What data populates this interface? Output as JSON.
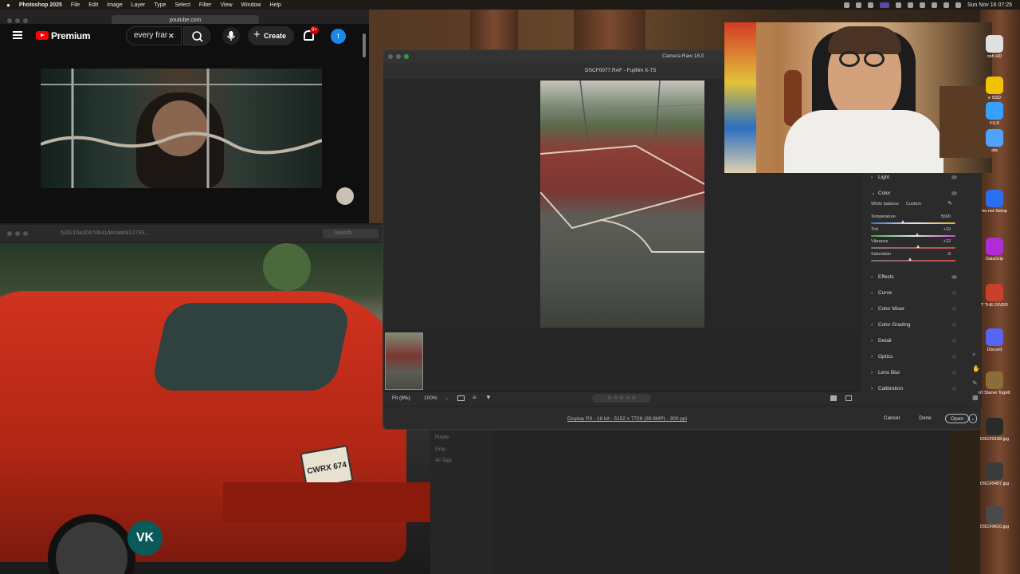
{
  "menubar": {
    "app": "Photoshop 2025",
    "items": [
      "File",
      "Edit",
      "Image",
      "Layer",
      "Type",
      "Select",
      "Filter",
      "View",
      "Window",
      "Help"
    ],
    "clock": "Sun Nov 16 07:25"
  },
  "youtube": {
    "url": "youtube.com",
    "brand": "Premium",
    "search_value": "every frar",
    "create_label": "Create",
    "notif_count": "9+",
    "avatar_letter": "t"
  },
  "viewer": {
    "title": "535215a30470b41de0aab912733...",
    "search_placeholder": "Search"
  },
  "lightroom": {
    "tags": [
      "Purple",
      "Gray",
      "All Tags"
    ]
  },
  "camera_raw": {
    "app_title": "Camera Raw 18.0",
    "file_title": "DSCF0077.RAF  -  Fujifilm X-T5",
    "zoom_fit": "Fit (8%)",
    "zoom_100": "100%",
    "stars": "☆ ☆ ☆ ☆ ☆",
    "footer_info": "Display P3 - 16 bit - 5152 x 7728 (39.8MP) - 300 ppi",
    "cancel": "Cancel",
    "done": "Done",
    "open": "Open",
    "panel": {
      "light": "Light",
      "color": "Color",
      "wb_label": "White balance",
      "wb_value": "Custom",
      "sliders": [
        {
          "label": "Temperature",
          "value": "5500",
          "pos": 0.38
        },
        {
          "label": "Tint",
          "value": "+10",
          "pos": 0.55
        },
        {
          "label": "Vibrance",
          "value": "+12",
          "pos": 0.56
        },
        {
          "label": "Saturation",
          "value": "-8",
          "pos": 0.47
        }
      ],
      "sections": [
        "Effects",
        "Curve",
        "Color Mixer",
        "Color Grading",
        "Detail",
        "Optics",
        "Lens Blur",
        "Calibration"
      ]
    }
  },
  "dock": [
    {
      "label": "osh HD",
      "color": "#e0e0e0"
    },
    {
      "label": "e SSD",
      "color": "#f2c200"
    },
    {
      "label": "FUJI",
      "color": "#3aa0ff"
    },
    {
      "label": "ata",
      "color": "#4fa3ff"
    },
    {
      "label": "ne.net-Setup",
      "color": "#2b6ff0"
    },
    {
      "label": "DataGrip",
      "color": "#b02cd6"
    },
    {
      "label": "T THE DIVER",
      "color": "#c9402a"
    },
    {
      "label": "Discord",
      "color": "#5865f2"
    },
    {
      "label": "n't Starve Together",
      "color": "#8a6d3b"
    },
    {
      "label": "DSCF9158.jpg",
      "color": "#2a2a2a"
    },
    {
      "label": "DSCF9497.jpg",
      "color": "#3b3b3b"
    },
    {
      "label": "DSCF9610.jpg",
      "color": "#4a4a4a"
    }
  ],
  "plate": "CWRX 674",
  "watermark": "VK"
}
